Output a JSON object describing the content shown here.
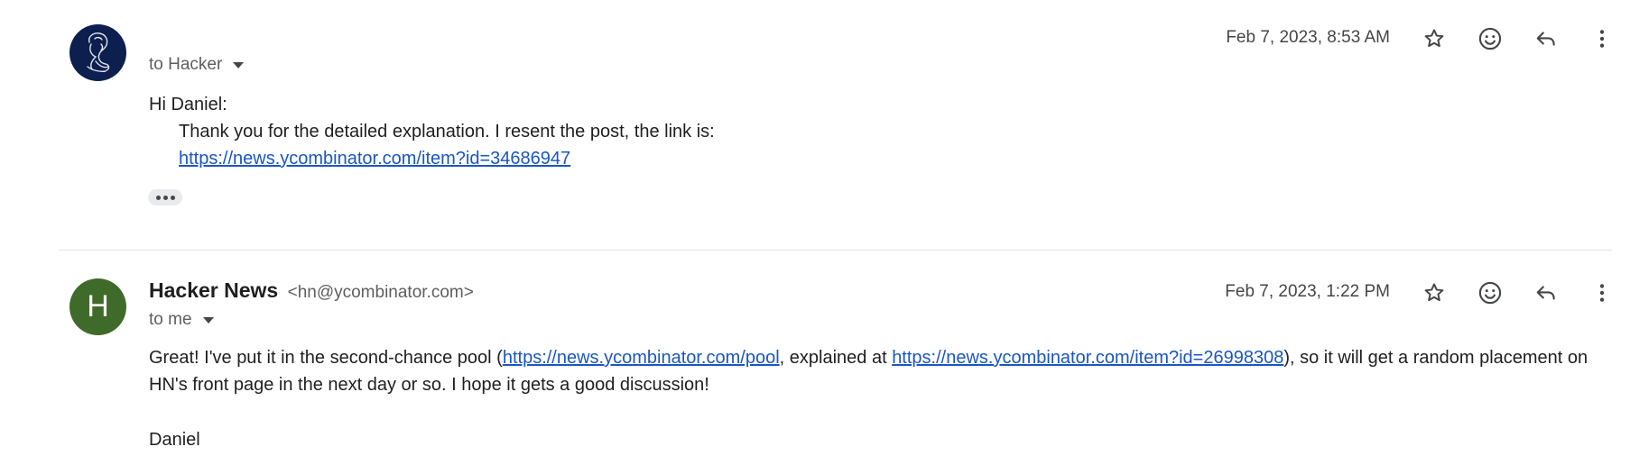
{
  "messages": [
    {
      "avatar": "sketch-avatar",
      "recipient": "to Hacker",
      "date": "Feb 7, 2023, 8:53 AM",
      "greeting": "Hi Daniel:",
      "body_line": "Thank you for the detailed explanation. I resent the post, the link is:",
      "link": "https://news.ycombinator.com/item?id=34686947"
    },
    {
      "avatar_letter": "H",
      "sender_name": "Hacker News",
      "sender_email": "<hn@ycombinator.com>",
      "recipient": "to me",
      "date": "Feb 7, 2023, 1:22 PM",
      "body_part1": "Great! I've put it in the second-chance pool (",
      "link1": "https://news.ycombinator.com/pool",
      "body_part2": ", explained at ",
      "link2": "https://news.ycombinator.com/item?id=26998308",
      "body_part3": "), so it will get a random placement on HN's front page in the next day or so. I hope it gets a good discussion!",
      "signature": "Daniel"
    }
  ],
  "icons": {
    "star": "star-icon",
    "emoji": "emoji-reaction-icon",
    "reply": "reply-icon",
    "more": "more-vert-icon",
    "caret": "caret-down-icon"
  },
  "colors": {
    "link": "#1a56c2",
    "avatar_green": "#3f6b2a",
    "avatar_navy": "#0d1f4e"
  }
}
